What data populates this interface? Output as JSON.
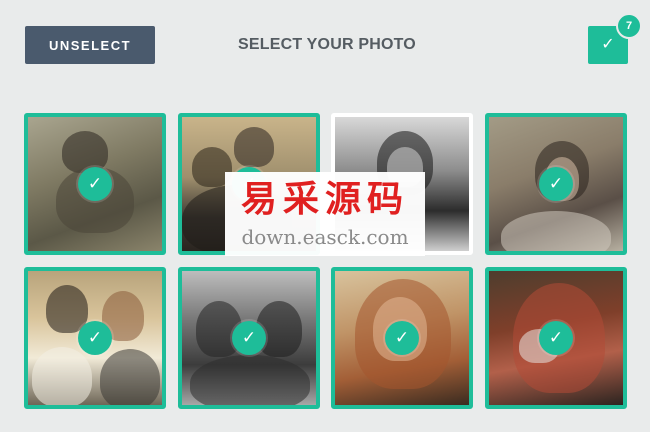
{
  "header": {
    "unselect_label": "UNSELECT",
    "title": "SELECT YOUR PHOTO",
    "selected_count": "7",
    "check_glyph": "✓"
  },
  "photos": [
    {
      "selected": true
    },
    {
      "selected": true
    },
    {
      "selected": false
    },
    {
      "selected": true
    },
    {
      "selected": true
    },
    {
      "selected": true
    },
    {
      "selected": true
    },
    {
      "selected": true
    }
  ],
  "watermark": {
    "title": "易采源码",
    "url": "down.easck.com"
  },
  "colors": {
    "accent": "#1ebd99",
    "button": "#4a5a6d",
    "background": "#e9ebeb",
    "watermark_red": "#e02020"
  }
}
